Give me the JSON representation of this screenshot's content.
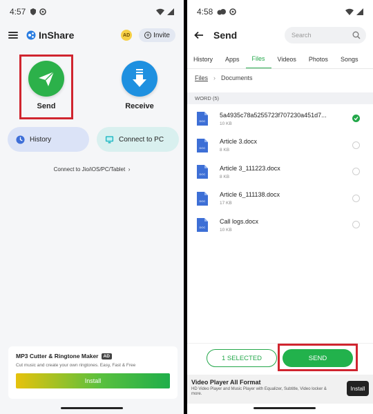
{
  "left": {
    "status": {
      "time": "4:57"
    },
    "header": {
      "brand": "InShare",
      "ad_badge": "AD",
      "invite_label": "Invite"
    },
    "send_label": "Send",
    "receive_label": "Receive",
    "history_label": "History",
    "connect_pc_label": "Connect to PC",
    "connect_link": "Connect to Jio/iOS/PC/Tablet",
    "ad": {
      "title": "MP3 Cutter & Ringtone Maker",
      "tag": "AD",
      "description": "Cut music and create your own ringtones. Easy, Fast & Free",
      "install_label": "Install"
    }
  },
  "right": {
    "status": {
      "time": "4:58"
    },
    "header": {
      "title": "Send",
      "search_placeholder": "Search"
    },
    "tabs": [
      {
        "label": "History"
      },
      {
        "label": "Apps"
      },
      {
        "label": "Files",
        "active": true
      },
      {
        "label": "Videos"
      },
      {
        "label": "Photos"
      },
      {
        "label": "Songs"
      }
    ],
    "breadcrumb": {
      "root": "Files",
      "current": "Documents"
    },
    "section": "WORD (5)",
    "files": [
      {
        "name": "5a4935c78a5255723f707230a451d7...",
        "size": "10 KB",
        "selected": true
      },
      {
        "name": "Article 3.docx",
        "size": "8 KB",
        "selected": false
      },
      {
        "name": "Article 3_111223.docx",
        "size": "8 KB",
        "selected": false
      },
      {
        "name": "Article 6_111138.docx",
        "size": "17 KB",
        "selected": false
      },
      {
        "name": "Call logs.docx",
        "size": "10 KB",
        "selected": false
      }
    ],
    "selected_label": "1 SELECTED",
    "send_label": "SEND",
    "ad": {
      "title": "Video Player All Format",
      "description": "HD Video Player and Music Player with Equalizer, Subtitle, Video locker & more.",
      "install_label": "Install"
    }
  },
  "colors": {
    "accent_green": "#22a749",
    "receive_blue": "#1e90e0",
    "highlight_red": "#d0252f"
  }
}
